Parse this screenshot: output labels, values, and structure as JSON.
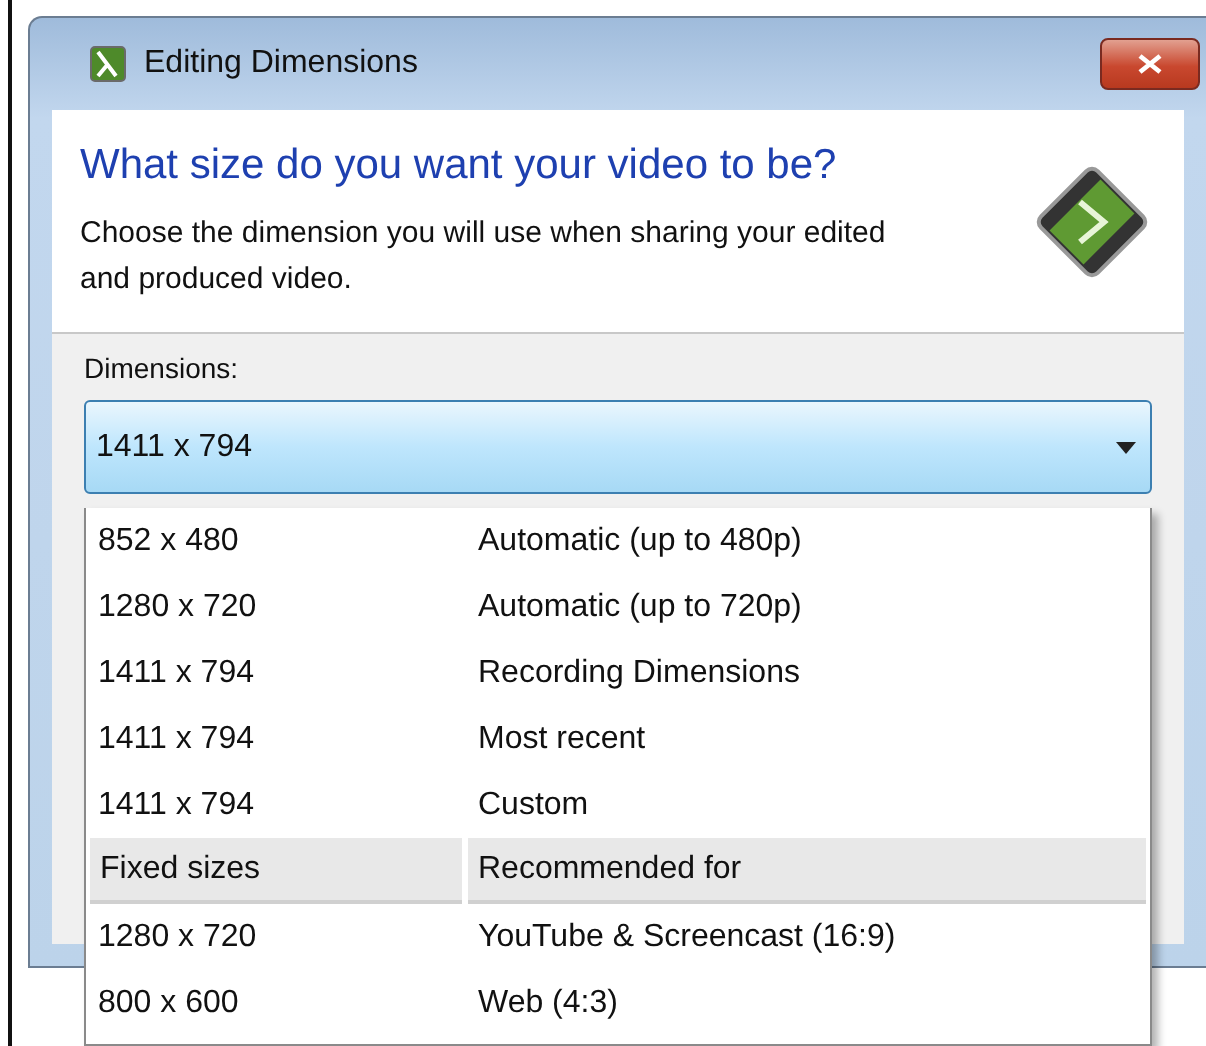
{
  "window": {
    "title": "Editing Dimensions"
  },
  "header": {
    "heading": "What size do you want your video to be?",
    "description": "Choose the dimension you will use when sharing your edited and produced video."
  },
  "dimensions": {
    "label": "Dimensions:",
    "value": "1411 x 794",
    "expanded": true,
    "options": [
      {
        "kind": "option",
        "size": "852 x 480",
        "use": "Automatic (up to 480p)"
      },
      {
        "kind": "option",
        "size": "1280 x 720",
        "use": "Automatic (up to 720p)"
      },
      {
        "kind": "option",
        "size": "1411 x 794",
        "use": "Recording Dimensions"
      },
      {
        "kind": "option",
        "size": "1411 x 794",
        "use": "Most recent"
      },
      {
        "kind": "option",
        "size": "1411 x 794",
        "use": "Custom"
      },
      {
        "kind": "header",
        "size": "Fixed sizes",
        "use": "Recommended for"
      },
      {
        "kind": "option",
        "size": "1280 x 720",
        "use": "YouTube & Screencast (16:9)"
      },
      {
        "kind": "option",
        "size": "800 x 600",
        "use": "Web (4:3)"
      }
    ]
  }
}
